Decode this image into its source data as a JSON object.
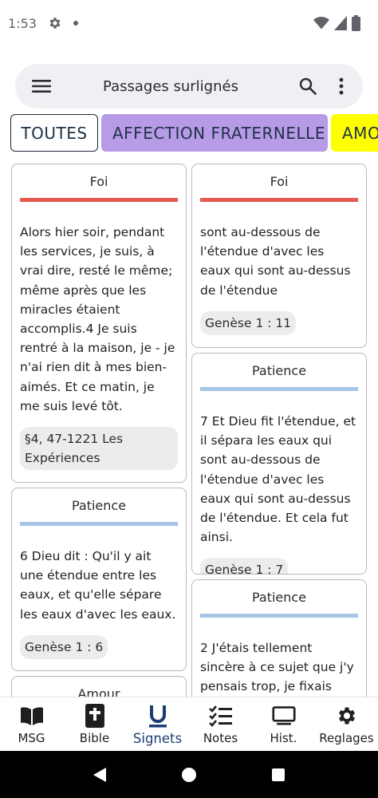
{
  "status_bar": {
    "time": "1:53"
  },
  "app_bar": {
    "title": "Passages surlignés"
  },
  "chips": [
    {
      "label": "TOUTES",
      "color": "#ffffff"
    },
    {
      "label": "AFFECTION FRATERNELLE",
      "color": "#b79be6"
    },
    {
      "label": "AMOUR",
      "color": "#ffff00"
    }
  ],
  "cards": {
    "left": [
      {
        "tag": "Foi",
        "tag_color": "#e8594f",
        "text": "Alors hier soir, pendant les services, je suis, à vrai dire, resté le même; même après que les miracles étaient accomplis.4 Je suis rentré à la maison, je - je n'ai rien dit à mes bien-aimés. Et ce matin, je me suis levé tôt.",
        "reference": "§4, 47-1221 Les Expériences"
      },
      {
        "tag": "Patience",
        "tag_color": "#a8c4e6",
        "text": "6 Dieu dit : Qu'il y ait une étendue entre les eaux, et qu'elle sépare les eaux d'avec les eaux.",
        "reference": "Genèse 1 : 6"
      },
      {
        "tag": "Amour",
        "tag_color": "#ffff00",
        "text": "",
        "reference": ""
      }
    ],
    "right": [
      {
        "tag": "Foi",
        "tag_color": "#e8594f",
        "text": " sont au-dessous de l'étendue d'avec les eaux qui sont au-dessus de l'étendue",
        "reference": "Genèse 1 : 11"
      },
      {
        "tag": "Patience",
        "tag_color": "#a8c4e6",
        "text": "7 Et Dieu fit l'étendue, et il sépara les eaux qui sont au-dessous de l'étendue d'avec les eaux qui sont au-dessus de l'étendue. Et cela fut ainsi.",
        "reference": "Genèse 1 : 7"
      },
      {
        "tag": "Patience",
        "tag_color": "#a8c4e6",
        "text": "2  J'étais tellement sincère à ce sujet que j'y pensais trop, je fixais",
        "reference": ""
      }
    ]
  },
  "bottom_nav": [
    {
      "label": "MSG",
      "icon": "open-book-icon",
      "active": false
    },
    {
      "label": "Bible",
      "icon": "bible-icon",
      "active": false
    },
    {
      "label": "Signets",
      "icon": "bookmark-u-icon",
      "active": true
    },
    {
      "label": "Notes",
      "icon": "checklist-icon",
      "active": false
    },
    {
      "label": "Hist.",
      "icon": "monitor-icon",
      "active": false
    },
    {
      "label": "Reglages",
      "icon": "gear-icon",
      "active": false
    }
  ],
  "colors": {
    "active_nav": "#1c3d73",
    "app_bar_bg": "#eef0f4"
  }
}
